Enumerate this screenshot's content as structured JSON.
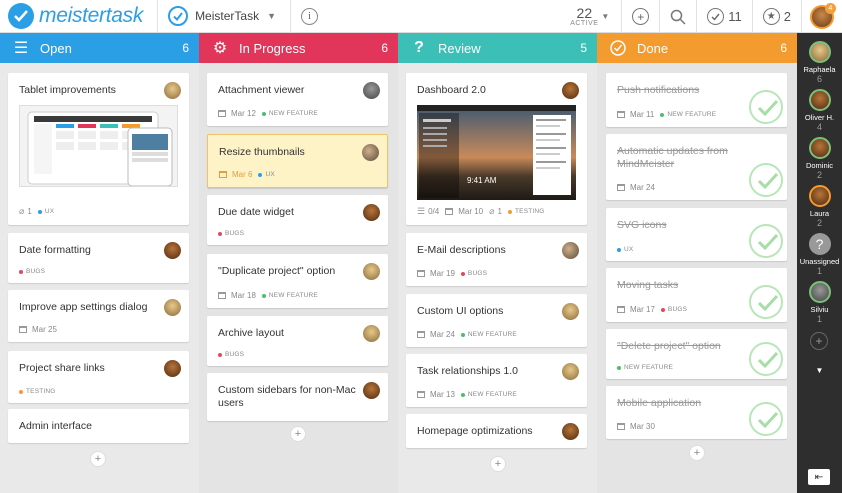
{
  "app": {
    "logo_text": "meistertask",
    "project_name": "MeisterTask",
    "brand_color": "#2b9fe6"
  },
  "toolbar": {
    "active_count": "22",
    "active_label": "ACTIVE",
    "completed_count": "11",
    "watched_count": "2",
    "user_badge": "4",
    "icons": [
      "add-icon",
      "search-icon",
      "checkmark-icon",
      "star-icon"
    ]
  },
  "columns": [
    {
      "title": "Open",
      "count": "6",
      "color": "#2b9fe6",
      "icon": "list-icon",
      "cards": [
        {
          "title": "Tablet improvements",
          "attachments": "1",
          "tag": "UX",
          "tag_color": "#2b9fe6"
        },
        {
          "title": "Date formatting",
          "tag": "BUGS",
          "tag_color": "#e24a5c"
        },
        {
          "title": "Improve app settings dialog",
          "date": "Mar 25"
        },
        {
          "title": "Project share links",
          "tag": "TESTING",
          "tag_color": "#f39b2e"
        },
        {
          "title": "Admin interface"
        }
      ]
    },
    {
      "title": "In Progress",
      "count": "6",
      "color": "#e1365a",
      "icon": "gear-icon",
      "cards": [
        {
          "title": "Attachment viewer",
          "date": "Mar 12",
          "tag": "NEW FEATURE",
          "tag_color": "#4cbf6c"
        },
        {
          "title": "Resize thumbnails",
          "date": "Mar 6",
          "tag": "UX",
          "tag_color": "#2b9fe6"
        },
        {
          "title": "Due date widget",
          "tag": "BUGS",
          "tag_color": "#e24a5c"
        },
        {
          "title": "\"Duplicate project\" option",
          "date": "Mar 18",
          "tag": "NEW FEATURE",
          "tag_color": "#4cbf6c"
        },
        {
          "title": "Archive layout",
          "tag": "BUGS",
          "tag_color": "#e24a5c"
        },
        {
          "title": "Custom sidebars for non-Mac users"
        }
      ]
    },
    {
      "title": "Review",
      "count": "5",
      "color": "#3bbfb7",
      "icon": "question-icon",
      "cards": [
        {
          "title": "Dashboard 2.0",
          "checklist": "0/4",
          "date": "Mar 10",
          "attachments": "1",
          "tag": "TESTING",
          "tag_color": "#f39b2e",
          "shot_time": "9:41 AM"
        },
        {
          "title": "E-Mail descriptions",
          "date": "Mar 19",
          "tag": "BUGS",
          "tag_color": "#e24a5c"
        },
        {
          "title": "Custom UI options",
          "date": "Mar 24",
          "tag": "NEW FEATURE",
          "tag_color": "#4cbf6c"
        },
        {
          "title": "Task relationships 1.0",
          "date": "Mar 13",
          "tag": "NEW FEATURE",
          "tag_color": "#4cbf6c"
        },
        {
          "title": "Homepage optimizations"
        }
      ]
    },
    {
      "title": "Done",
      "count": "6",
      "color": "#f39b2e",
      "icon": "check-circle-icon",
      "cards": [
        {
          "title": "Push notifications",
          "date": "Mar 11",
          "tag": "NEW FEATURE",
          "tag_color": "#4cbf6c"
        },
        {
          "title": "Automatic updates from MindMeister",
          "date": "Mar 24"
        },
        {
          "title": "SVG icons",
          "tag": "UX",
          "tag_color": "#2b9fe6"
        },
        {
          "title": "Moving tasks",
          "date": "Mar 17",
          "tag": "BUGS",
          "tag_color": "#e24a5c"
        },
        {
          "title": "\"Delete project\" option",
          "tag": "NEW FEATURE",
          "tag_color": "#4cbf6c"
        },
        {
          "title": "Mobile application",
          "date": "Mar 30"
        }
      ]
    }
  ],
  "sidebar": {
    "users": [
      {
        "name": "Raphaela",
        "count": "6"
      },
      {
        "name": "Oliver H.",
        "count": "4"
      },
      {
        "name": "Dominic",
        "count": "2"
      },
      {
        "name": "Laura",
        "count": "2"
      },
      {
        "name": "Unassigned",
        "count": "1"
      },
      {
        "name": "Silviu",
        "count": "1"
      }
    ]
  }
}
